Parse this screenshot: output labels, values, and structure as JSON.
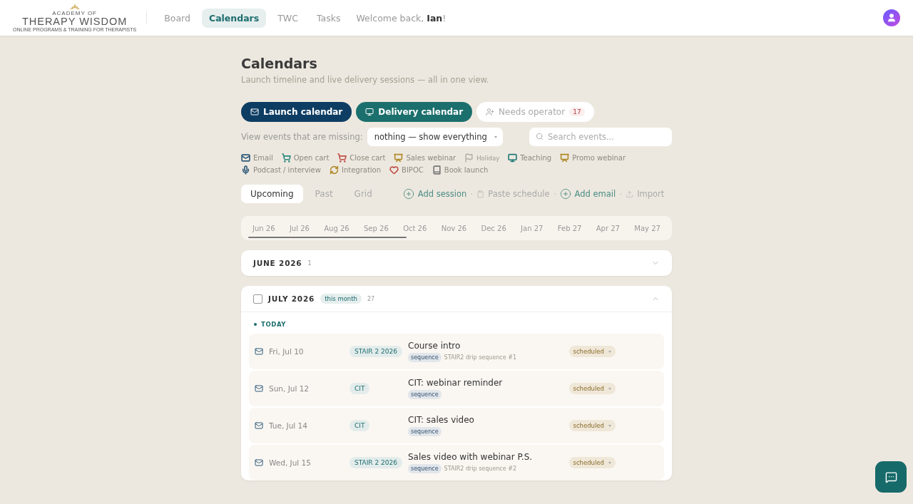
{
  "header": {
    "logo": {
      "small": "ACADEMY OF",
      "name": "THERAPY WISDOM",
      "tagline": "ONLINE PROGRAMS & TRAINING FOR THERAPISTS"
    },
    "nav": [
      {
        "label": "Board",
        "selected": false
      },
      {
        "label": "Calendars",
        "selected": true
      },
      {
        "label": "TWC",
        "selected": false
      },
      {
        "label": "Tasks",
        "selected": false
      }
    ],
    "welcome": {
      "text": "Welcome back, **Ian**!"
    }
  },
  "page": {
    "title": "Calendars",
    "subtitle": "Launch timeline and live delivery sessions — all in one view."
  },
  "calendar_buttons": [
    {
      "kind": "launch",
      "label": "Launch calendar"
    },
    {
      "kind": "delivery",
      "label": "Delivery calendar"
    },
    {
      "kind": "operator",
      "label": "Needs operator",
      "count": "17"
    }
  ],
  "filter": {
    "label": "View events that are missing:",
    "value": "nothing — show everything"
  },
  "search": {
    "placeholder": "Search events..."
  },
  "legend": [
    {
      "kind": "email",
      "label": "Email",
      "color": "#2f5a7a",
      "dimmed": false
    },
    {
      "kind": "cart",
      "label": "Open cart",
      "color": "#2a8a80",
      "dimmed": false
    },
    {
      "kind": "cartx",
      "label": "Close cart",
      "color": "#c0504a",
      "dimmed": false
    },
    {
      "kind": "presentation",
      "label": "Sales webinar",
      "color": "#b08a2a",
      "dimmed": false
    },
    {
      "kind": "flag",
      "label": "Holiday",
      "color": "#b8b4aa",
      "dimmed": true
    },
    {
      "kind": "monitor",
      "label": "Teaching",
      "color": "#1f7a78",
      "dimmed": false
    },
    {
      "kind": "presentation",
      "label": "Promo webinar",
      "color": "#b08a2a",
      "dimmed": false
    },
    {
      "kind": "mic",
      "label": "Podcast / interview",
      "color": "#2f5a7a",
      "dimmed": false
    },
    {
      "kind": "refresh",
      "label": "Integration",
      "color": "#b08a2a",
      "dimmed": false
    },
    {
      "kind": "heart",
      "label": "BIPOC",
      "color": "#c0504a",
      "dimmed": false
    },
    {
      "kind": "book",
      "label": "Book launch",
      "color": "#777777",
      "dimmed": false
    }
  ],
  "view_tabs": [
    {
      "label": "Upcoming",
      "selected": true
    },
    {
      "label": "Past",
      "selected": false
    },
    {
      "label": "Grid",
      "selected": false
    }
  ],
  "actions": [
    {
      "kind": "add",
      "label": "Add session"
    },
    {
      "kind": "paste",
      "label": "Paste schedule"
    },
    {
      "kind": "add",
      "label": "Add email"
    },
    {
      "kind": "import",
      "label": "Import"
    }
  ],
  "months_strip": [
    "Jun 26",
    "Jul 26",
    "Aug 26",
    "Sep 26",
    "Oct 26",
    "Nov 26",
    "Dec 26",
    "Jan 27",
    "Feb 27",
    "Apr 27",
    "May 27"
  ],
  "sections": [
    {
      "title": "JUNE 2026",
      "count": "1",
      "expanded": false
    },
    {
      "title": "JULY 2026",
      "badge": "this month",
      "count": "27",
      "expanded": true,
      "checked": false,
      "group_label": "TODAY",
      "events": [
        {
          "date": "Fri, Jul 10",
          "program": "STAIR 2 2026",
          "title": "Course intro",
          "tag": "sequence",
          "note": "STAIR2 drip sequence #1",
          "status": "scheduled"
        },
        {
          "date": "Sun, Jul 12",
          "program": "CIT",
          "title": "CIT: webinar reminder",
          "tag": "sequence",
          "status": "scheduled"
        },
        {
          "date": "Tue, Jul 14",
          "program": "CIT",
          "title": "CIT: sales video",
          "tag": "sequence",
          "status": "scheduled"
        },
        {
          "date": "Wed, Jul 15",
          "program": "STAIR 2 2026",
          "title": "Sales video with webinar P.S.",
          "tag": "sequence",
          "note": "STAIR2 drip sequence #2",
          "status": "scheduled"
        }
      ]
    }
  ]
}
